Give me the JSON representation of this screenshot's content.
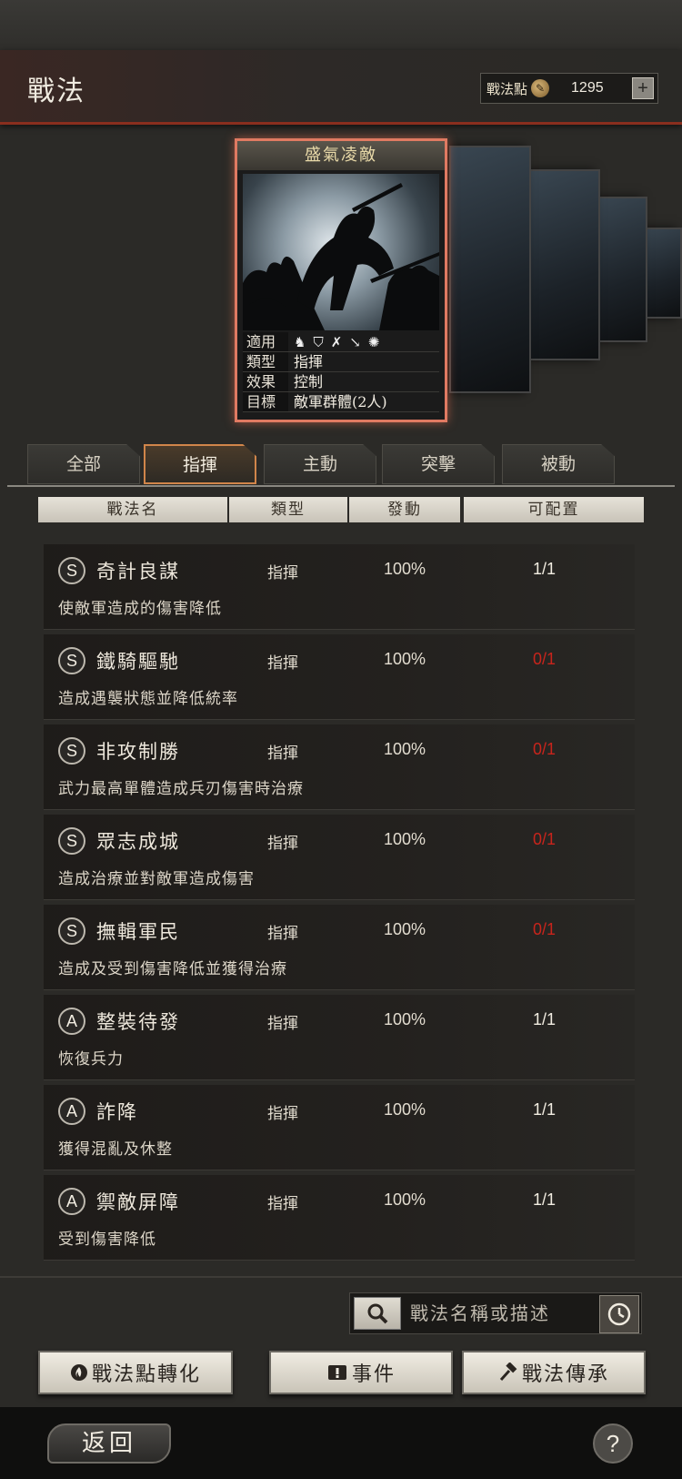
{
  "header": {
    "title": "戰法",
    "points_label": "戰法點",
    "points_value": "1295",
    "plus_label": "+"
  },
  "featured_card": {
    "name": "盛氣凌敵",
    "rows": [
      {
        "label": "適用",
        "value": ""
      },
      {
        "label": "類型",
        "value": "指揮"
      },
      {
        "label": "效果",
        "value": "控制"
      },
      {
        "label": "目標",
        "value": "敵軍群體(2人)"
      }
    ],
    "unit_icons": [
      "cavalry-icon",
      "shield-icon",
      "bow-icon",
      "spear-icon",
      "wheel-icon"
    ]
  },
  "tabs": [
    {
      "label": "全部"
    },
    {
      "label": "指揮"
    },
    {
      "label": "主動"
    },
    {
      "label": "突擊"
    },
    {
      "label": "被動"
    }
  ],
  "active_tab": "指揮",
  "columns": [
    "戰法名",
    "類型",
    "發動",
    "可配置"
  ],
  "skills": [
    {
      "grade": "S",
      "name": "奇計良謀",
      "type": "指揮",
      "rate": "100%",
      "available": "1/1",
      "desc": "使敵軍造成的傷害降低"
    },
    {
      "grade": "S",
      "name": "鐵騎驅馳",
      "type": "指揮",
      "rate": "100%",
      "available": "0/1",
      "desc": "造成遇襲狀態並降低統率"
    },
    {
      "grade": "S",
      "name": "非攻制勝",
      "type": "指揮",
      "rate": "100%",
      "available": "0/1",
      "desc": "武力最高單體造成兵刃傷害時治療"
    },
    {
      "grade": "S",
      "name": "眾志成城",
      "type": "指揮",
      "rate": "100%",
      "available": "0/1",
      "desc": "造成治療並對敵軍造成傷害"
    },
    {
      "grade": "S",
      "name": "撫輯軍民",
      "type": "指揮",
      "rate": "100%",
      "available": "0/1",
      "desc": "造成及受到傷害降低並獲得治療"
    },
    {
      "grade": "A",
      "name": "整裝待發",
      "type": "指揮",
      "rate": "100%",
      "available": "1/1",
      "desc": "恢復兵力"
    },
    {
      "grade": "A",
      "name": "詐降",
      "type": "指揮",
      "rate": "100%",
      "available": "1/1",
      "desc": "獲得混亂及休整"
    },
    {
      "grade": "A",
      "name": "禦敵屏障",
      "type": "指揮",
      "rate": "100%",
      "available": "1/1",
      "desc": "受到傷害降低"
    }
  ],
  "colors": {
    "unavailable": "#c8241c",
    "accent": "#d0854a",
    "card_border": "#e07a62"
  },
  "search": {
    "placeholder": "戰法名稱或描述"
  },
  "actions": {
    "convert": "戰法點轉化",
    "event": "事件",
    "inherit": "戰法傳承"
  },
  "footer": {
    "back": "返回",
    "help": "?"
  }
}
